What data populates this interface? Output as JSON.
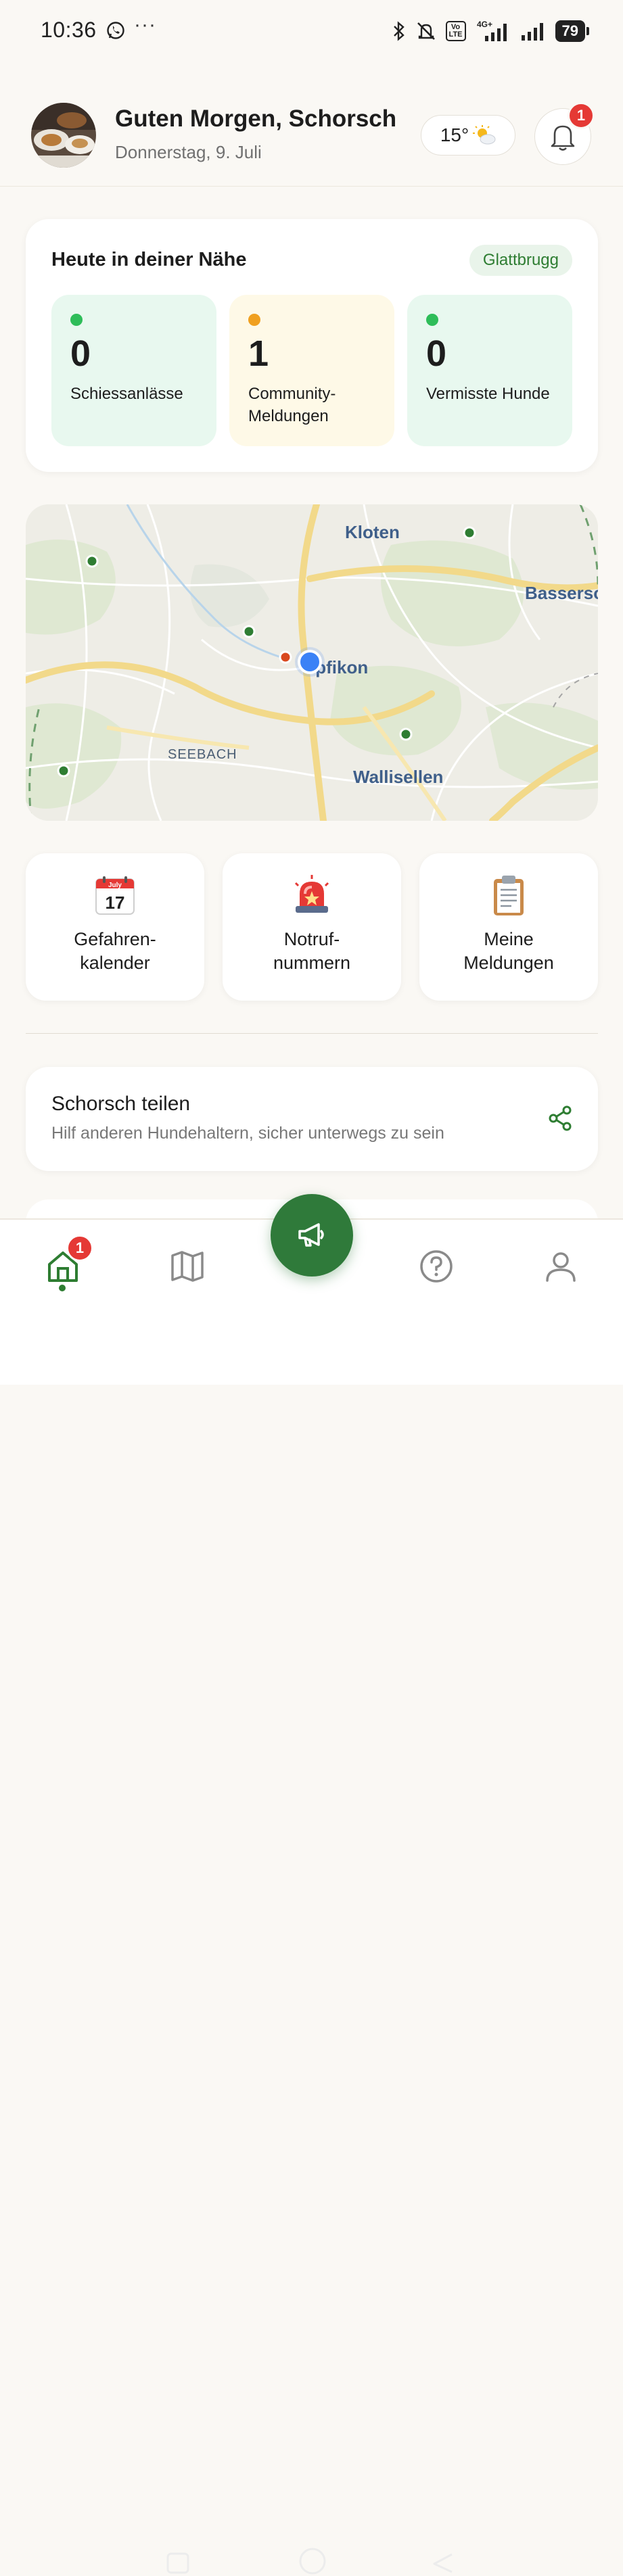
{
  "status_bar": {
    "time": "10:36",
    "more": "···",
    "network": "4G+",
    "lte": "Vo LTE",
    "battery": "79"
  },
  "header": {
    "greeting": "Guten Morgen, Schorsch",
    "date": "Donnerstag, 9. Juli",
    "weather_temp": "15°",
    "weather_icon": "sun-behind-cloud-icon",
    "notification_count": "1"
  },
  "nearby": {
    "title": "Heute in deiner Nähe",
    "location": "Glattbrugg",
    "stats": [
      {
        "value": "0",
        "label": "Schiessanlässe",
        "dot_color": "#2ebd59",
        "bg": "#e8f8ef"
      },
      {
        "value": "1",
        "label": "Community-Meldungen",
        "dot_color": "#f0a020",
        "bg": "#fef9e7"
      },
      {
        "value": "0",
        "label": "Vermisste Hunde",
        "dot_color": "#2ebd59",
        "bg": "#e8f8ef"
      }
    ]
  },
  "map": {
    "labels": {
      "kloten": "Kloten",
      "bassersdorf": "Basserso",
      "opfikon": "Opfikon",
      "seebach": "SEEBACH",
      "wallisellen": "Wallisellen"
    }
  },
  "quick_actions": [
    {
      "icon": "calendar-icon",
      "calendar_month": "July",
      "calendar_day": "17",
      "label": "Gefahren-kalender"
    },
    {
      "icon": "siren-icon",
      "label": "Notruf-nummern"
    },
    {
      "icon": "clipboard-icon",
      "label": "Meine Meldungen"
    }
  ],
  "share": {
    "title": "Schorsch teilen",
    "subtitle": "Hilf anderen Hundehaltern, sicher unterwegs zu sein",
    "icon": "share-icon"
  },
  "bottom_nav": {
    "home_badge": "1",
    "items": [
      "home-icon",
      "map-icon",
      "megaphone-icon",
      "help-icon",
      "profile-icon"
    ]
  },
  "colors": {
    "accent": "#2f7a3a",
    "badge": "#e53935",
    "background": "#faf8f4"
  }
}
